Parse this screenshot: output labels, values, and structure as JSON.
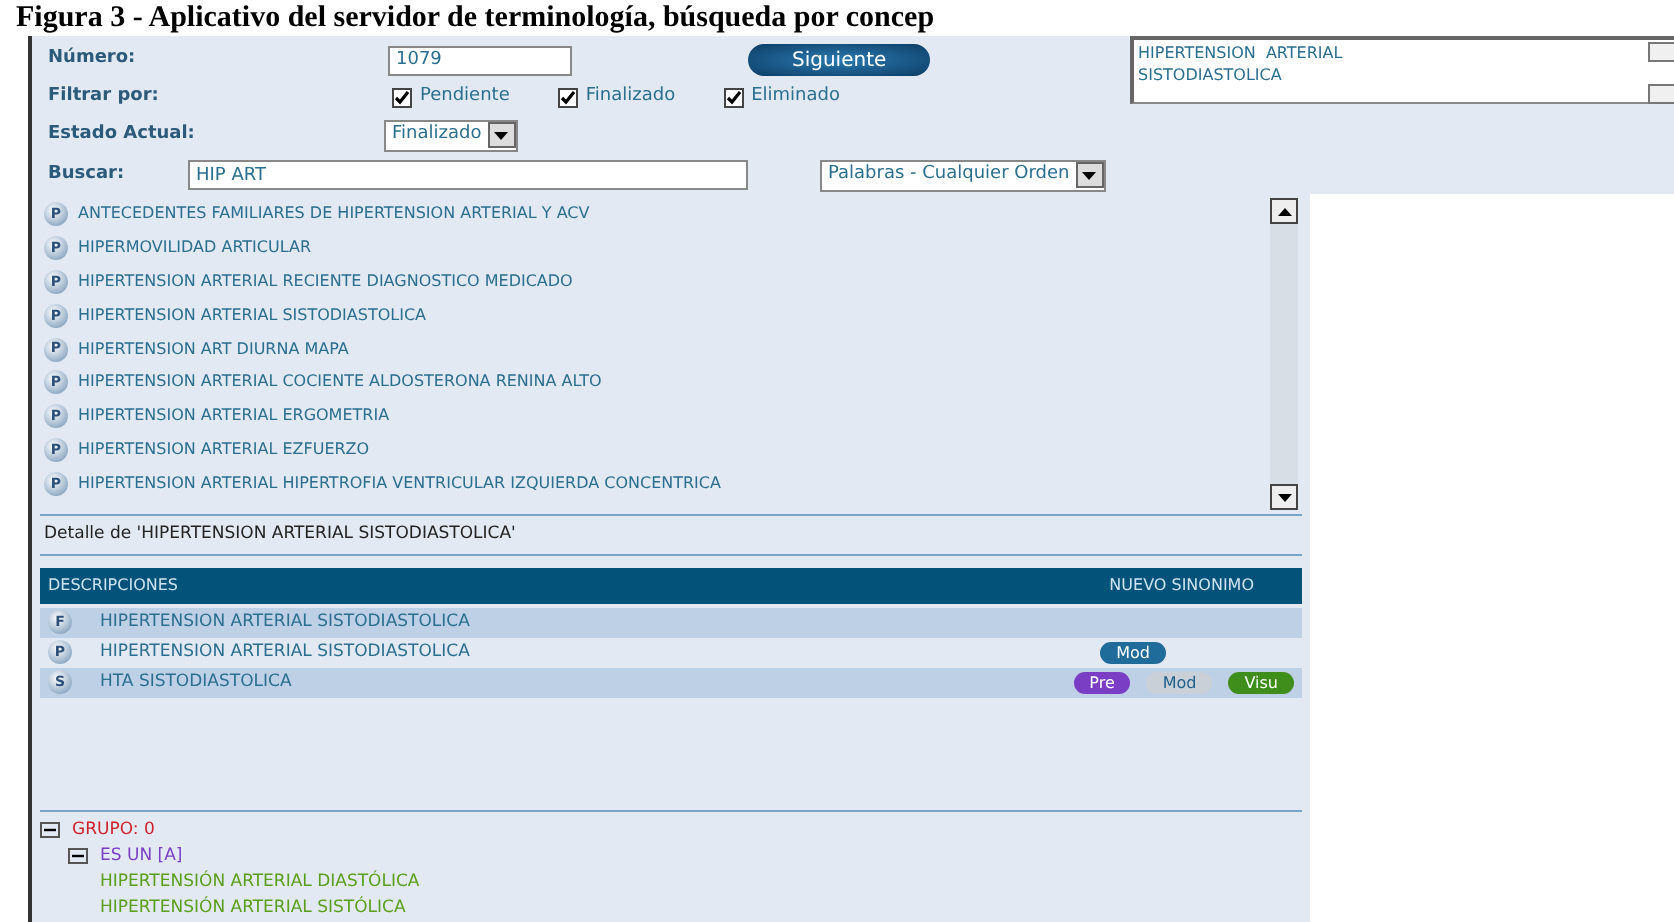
{
  "caption": "Figura 3 - Aplicativo del servidor de terminología, búsqueda por concep",
  "form": {
    "numero_label": "Número:",
    "numero_value": "1079",
    "next_button": "Siguiente",
    "filter_label": "Filtrar por:",
    "filters": [
      {
        "label": "Pendiente",
        "checked": true
      },
      {
        "label": "Finalizado",
        "checked": true
      },
      {
        "label": "Eliminado",
        "checked": true
      }
    ],
    "state_label": "Estado Actual:",
    "state_value": "Finalizado",
    "search_label": "Buscar:",
    "search_value": "HIP ART",
    "search_mode": "Palabras - Cualquier Orden",
    "concept_text": "HIPERTENSION  ARTERIAL\nSISTODIASTOLICA"
  },
  "results": [
    {
      "badge": "P",
      "text": "ANTECEDENTES FAMILIARES DE HIPERTENSION ARTERIAL Y ACV"
    },
    {
      "badge": "P",
      "text": "HIPERMOVILIDAD ARTICULAR"
    },
    {
      "badge": "P",
      "text": "HIPERTENSION ARTERIAL RECIENTE DIAGNOSTICO MEDICADO"
    },
    {
      "badge": "P",
      "text": "HIPERTENSION ARTERIAL SISTODIASTOLICA"
    },
    {
      "badge": "P",
      "text": "HIPERTENSION ART DIURNA MAPA"
    },
    {
      "badge": "P",
      "text": "HIPERTENSION ARTERIAL COCIENTE ALDOSTERONA RENINA ALTO"
    },
    {
      "badge": "P",
      "text": "HIPERTENSION ARTERIAL ERGOMETRIA"
    },
    {
      "badge": "P",
      "text": "HIPERTENSION ARTERIAL EZFUERZO"
    },
    {
      "badge": "P",
      "text": "HIPERTENSION ARTERIAL HIPERTROFIA VENTRICULAR IZQUIERDA CONCENTRICA"
    }
  ],
  "detail_title": "Detalle de 'HIPERTENSION  ARTERIAL SISTODIASTOLICA'",
  "table": {
    "columns": [
      "DESCRIPCIONES",
      "NUEVO SINONIMO"
    ],
    "rows": [
      {
        "badge": "F",
        "text": "HIPERTENSION ARTERIAL SISTODIASTOLICA",
        "buttons": []
      },
      {
        "badge": "P",
        "text": "HIPERTENSION ARTERIAL SISTODIASTOLICA",
        "buttons": [
          {
            "label": "Mod",
            "color": "#1f6b9a"
          }
        ]
      },
      {
        "badge": "S",
        "text": "HTA SISTODIASTOLICA",
        "buttons": [
          {
            "label": "Pre",
            "color": "#7a3ec4"
          },
          {
            "label": "Mod",
            "color": "#c9d0d8"
          },
          {
            "label": "Visu",
            "color": "#3f8e1c"
          }
        ]
      }
    ]
  },
  "tree": [
    {
      "text": "GRUPO: 0",
      "expanded": true,
      "color": "#d0202a",
      "children": [
        {
          "text": "ES UN [A]",
          "expanded": true,
          "color": "#7a3ec4",
          "children": [
            {
              "text": "HIPERTENSIÓN ARTERIAL DIASTÓLICA",
              "color": "#5a9e1a"
            },
            {
              "text": "HIPERTENSIÓN ARTERIAL SISTÓLICA",
              "color": "#5a9e1a"
            }
          ]
        }
      ]
    }
  ]
}
